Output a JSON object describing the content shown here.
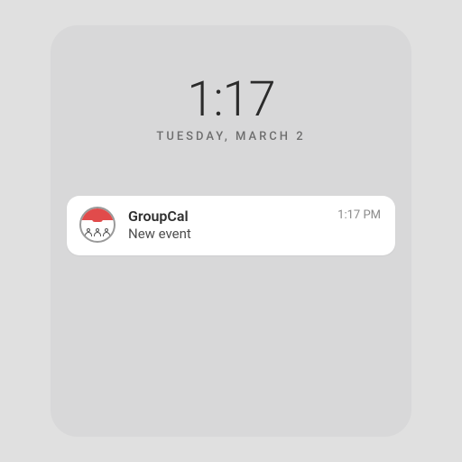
{
  "lockscreen": {
    "time": "1:17",
    "date": "TUESDAY, MARCH 2"
  },
  "notification": {
    "app_name": "GroupCal",
    "message": "New event",
    "timestamp": "1:17 PM",
    "icon": "groupcal-app-icon"
  }
}
